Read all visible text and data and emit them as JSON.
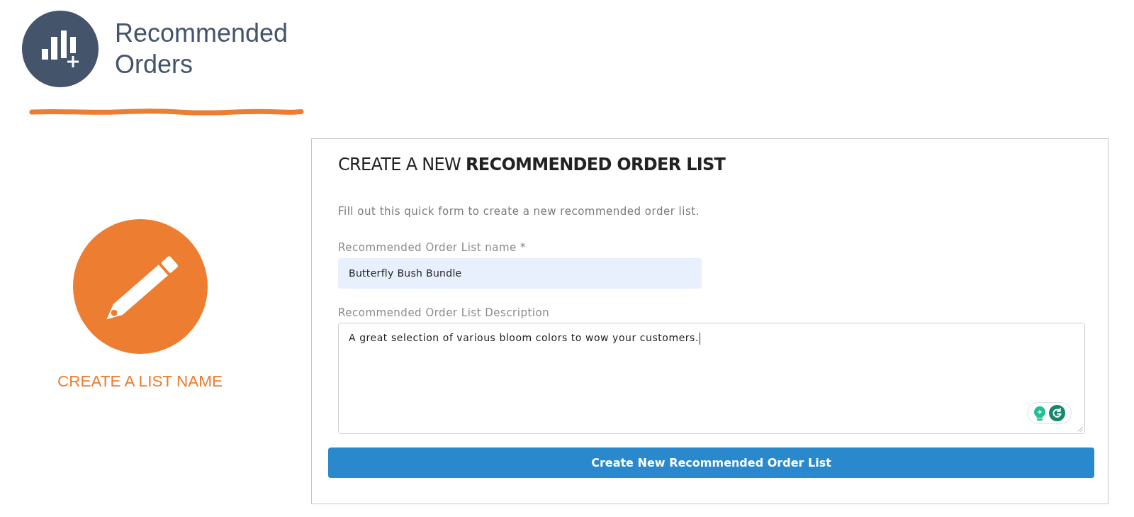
{
  "header": {
    "title": "Recommended Orders"
  },
  "step": {
    "label": "CREATE A LIST NAME"
  },
  "form": {
    "title": "CREATE A NEW **RECOMMENDED ORDER LIST**",
    "intro": "Fill out this quick form to create a new recommended order list.",
    "fields": [
      {
        "kind": "input",
        "label": "Recommended Order List name *",
        "value": "Butterfly Bush Bundle",
        "focused": false
      },
      {
        "kind": "textarea",
        "label": "Recommended Order List Description",
        "value": "A great selection of various bloom colors to wow your customers.",
        "focused": true
      }
    ],
    "submit": "Create New Recommended Order List"
  }
}
